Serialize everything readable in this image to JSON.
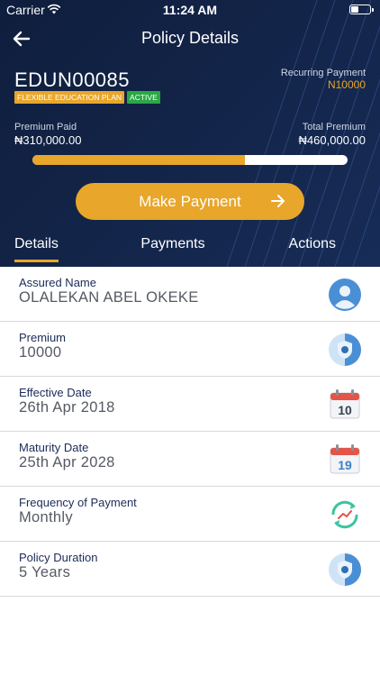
{
  "status_bar": {
    "carrier": "Carrier",
    "time": "11:24 AM"
  },
  "nav": {
    "title": "Policy Details"
  },
  "policy": {
    "number": "EDUN00085",
    "plan_tag": "FLEXIBLE EDUCATION PLAN",
    "status_tag": "ACTIVE",
    "recurring_label": "Recurring Payment",
    "recurring_value": "N10000",
    "premium_paid_label": "Premium Paid",
    "premium_paid_value": "₦310,000.00",
    "total_premium_label": "Total Premium",
    "total_premium_value": "₦460,000.00",
    "progress_fraction": 0.674
  },
  "actions": {
    "make_payment": "Make Payment"
  },
  "tabs": [
    {
      "label": "Details",
      "selected": true
    },
    {
      "label": "Payments",
      "selected": false
    },
    {
      "label": "Actions",
      "selected": false
    }
  ],
  "details": [
    {
      "label": "Assured Name",
      "value": "OLALEKAN ABEL OKEKE",
      "icon": "user-avatar-icon"
    },
    {
      "label": "Premium",
      "value": "10000",
      "icon": "shield-coin-icon"
    },
    {
      "label": "Effective Date",
      "value": "26th Apr 2018",
      "icon": "calendar-icon",
      "icon_text": "10"
    },
    {
      "label": "Maturity Date",
      "value": "25th Apr 2028",
      "icon": "calendar-icon",
      "icon_text": "19"
    },
    {
      "label": "Frequency of Payment",
      "value": "Monthly",
      "icon": "refresh-chart-icon"
    },
    {
      "label": "Policy Duration",
      "value": "5 Years",
      "icon": "shield-coin-icon"
    }
  ],
  "colors": {
    "header_bg": "#13254a",
    "accent": "#e8a62a",
    "active_green": "#2aa845",
    "label_navy": "#1b2b58"
  }
}
